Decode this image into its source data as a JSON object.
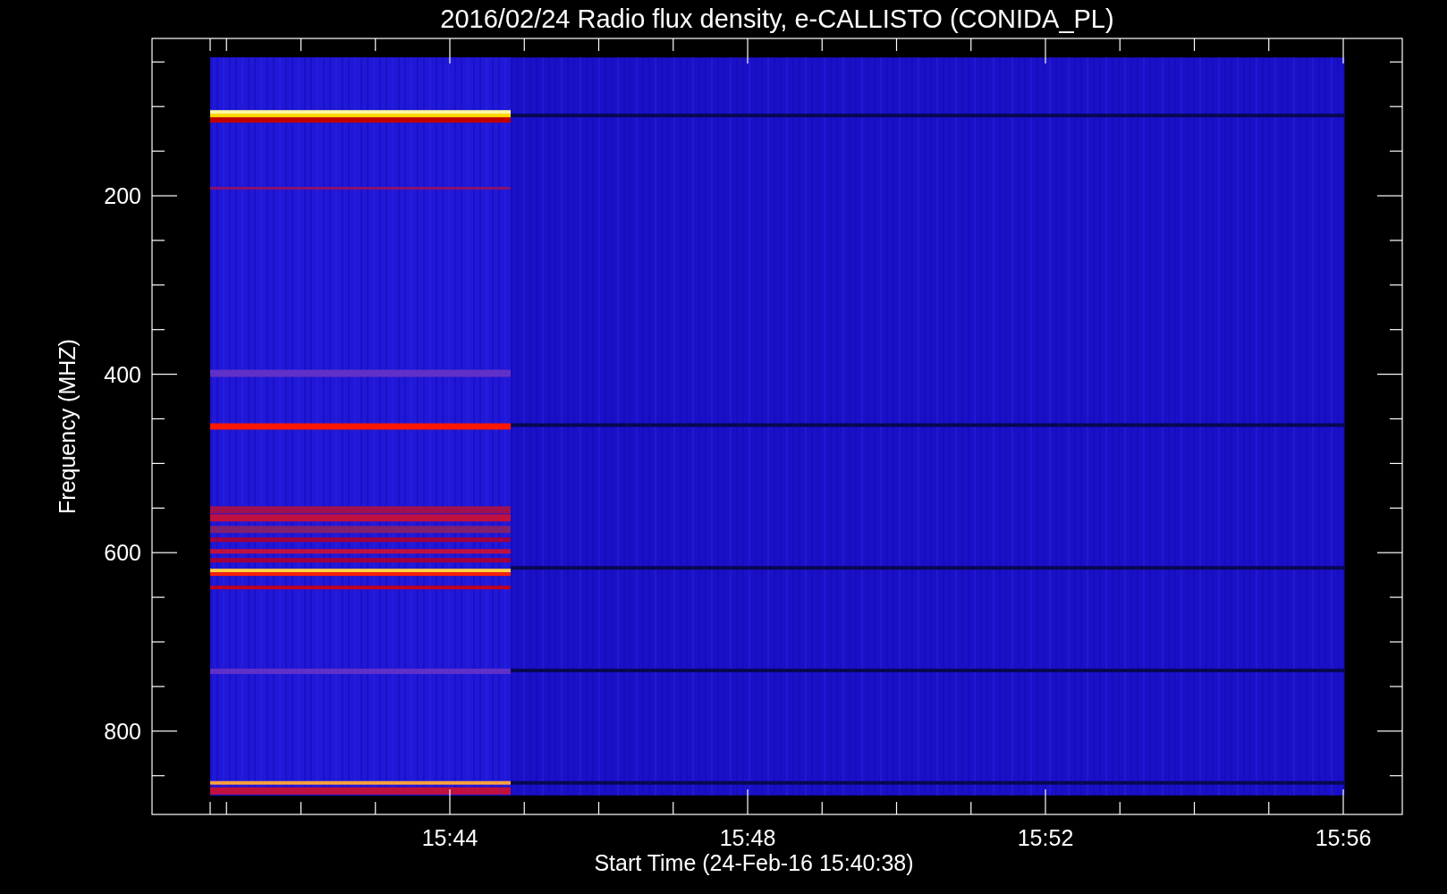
{
  "title": "2016/02/24  Radio flux density, e-CALLISTO (CONIDA_PL)",
  "y_axis": {
    "label": "Frequency (MHZ)",
    "ticks": [
      "200",
      "400",
      "600",
      "800"
    ]
  },
  "x_axis": {
    "label": "Start Time (24-Feb-16 15:40:38)",
    "ticks": [
      "15:44",
      "15:48",
      "15:52",
      "15:56"
    ]
  }
}
